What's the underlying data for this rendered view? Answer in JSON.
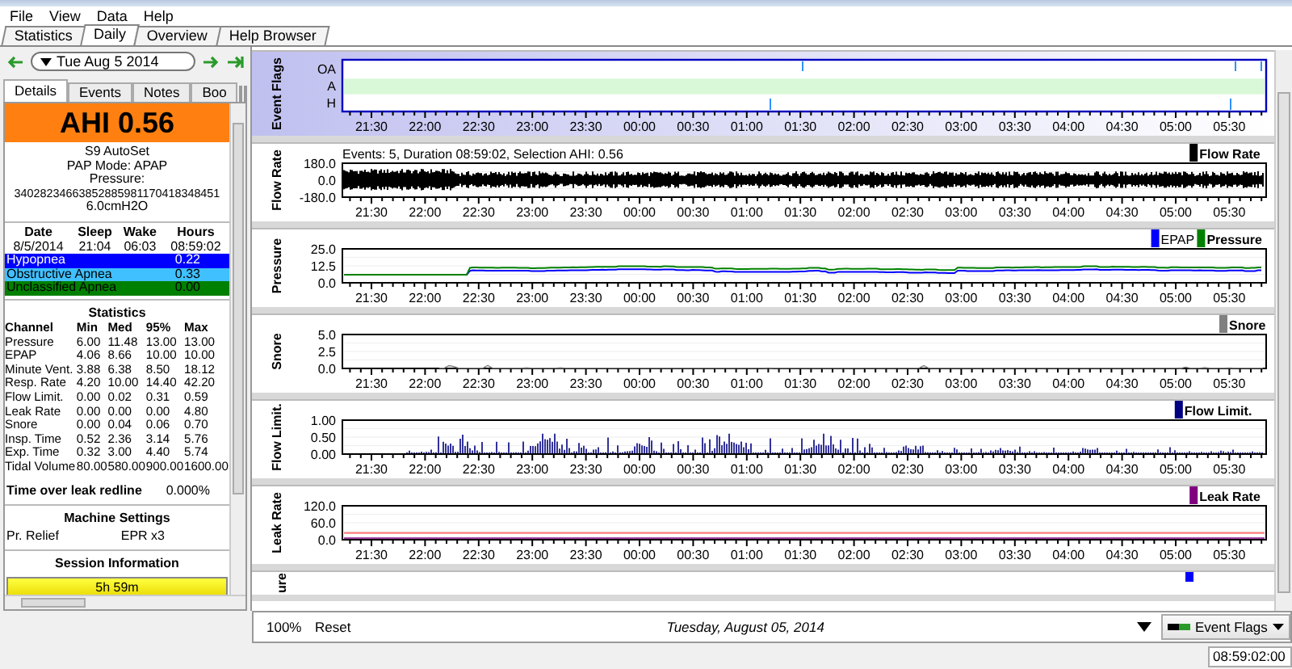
{
  "menu": [
    "File",
    "View",
    "Data",
    "Help"
  ],
  "tabs": [
    {
      "label": "Statistics",
      "selected": false
    },
    {
      "label": "Daily",
      "selected": true
    },
    {
      "label": "Overview",
      "selected": false
    },
    {
      "label": "Help Browser",
      "selected": false
    }
  ],
  "left": {
    "date": "Tue Aug 5 2014",
    "subtabs": [
      {
        "label": "Details",
        "selected": true
      },
      {
        "label": "Events",
        "selected": false
      },
      {
        "label": "Notes",
        "selected": false
      },
      {
        "label": "Boo",
        "selected": false
      }
    ],
    "ahi": "AHI 0.56",
    "machine_info": [
      "S9 AutoSet",
      "PAP Mode: APAP",
      "Pressure:",
      "34028234663852885981170418348451",
      "6.0cmH2O"
    ],
    "session_columns": [
      "Date",
      "Sleep",
      "Wake",
      "Hours"
    ],
    "session_values": [
      "8/5/2014",
      "21:04",
      "06:03",
      "08:59:02"
    ],
    "event_indices": [
      {
        "label": "Hypopnea",
        "value": "0.22",
        "color": "#0000ff"
      },
      {
        "label": "Obstructive Apnea",
        "value": "0.33",
        "color": "#40c0ff"
      },
      {
        "label": "Unclassified Apnea",
        "value": "0.00",
        "color": "#008000"
      }
    ],
    "statistics": {
      "title": "Statistics",
      "columns": [
        "Channel",
        "Min",
        "Med",
        "95%",
        "Max"
      ],
      "rows": [
        [
          "Pressure",
          "6.00",
          "11.48",
          "13.00",
          "13.00"
        ],
        [
          "EPAP",
          "4.06",
          "8.66",
          "10.00",
          "10.00"
        ],
        [
          "Minute Vent.",
          "3.88",
          "6.38",
          "8.50",
          "18.12"
        ],
        [
          "Resp. Rate",
          "4.20",
          "10.00",
          "14.40",
          "42.20"
        ],
        [
          "Flow Limit.",
          "0.00",
          "0.02",
          "0.31",
          "0.59"
        ],
        [
          "Leak Rate",
          "0.00",
          "0.00",
          "0.00",
          "4.80"
        ],
        [
          "Snore",
          "0.00",
          "0.04",
          "0.06",
          "0.70"
        ],
        [
          "Insp. Time",
          "0.52",
          "2.36",
          "3.14",
          "5.76"
        ],
        [
          "Exp. Time",
          "0.32",
          "3.00",
          "4.40",
          "5.74"
        ],
        [
          "Tidal Volume",
          "80.00",
          "580.00",
          "900.00",
          "1600.00"
        ]
      ]
    },
    "leak_redline": {
      "label": "Time over leak redline",
      "value": "0.000%"
    },
    "machine_settings": {
      "title": "Machine Settings",
      "rows": [
        {
          "label": "Pr. Relief",
          "value": "EPR x3"
        }
      ]
    },
    "session_information": {
      "title": "Session Information",
      "bar_label": "5h 59m"
    }
  },
  "graphs": [
    {
      "kind": "flags",
      "title": "Event Flags",
      "rows": [
        {
          "label": "OA",
          "highlighted": false
        },
        {
          "label": "A",
          "highlighted": true
        },
        {
          "label": "H",
          "highlighted": false
        }
      ],
      "x_labels": [
        "21:30",
        "22:00",
        "22:30",
        "23:00",
        "23:30",
        "00:00",
        "00:30",
        "01:00",
        "01:30",
        "02:00",
        "02:30",
        "03:00",
        "03:30",
        "04:00",
        "04:30",
        "05:00",
        "05:30"
      ]
    },
    {
      "kind": "flow",
      "title": "Flow Rate",
      "header": "Events: 5, Duration 08:59:02, Selection AHI: 0.56",
      "y_labels": [
        "180.0",
        "0.0",
        "-180.0"
      ],
      "legend": [
        {
          "label": "Flow Rate",
          "color": "#000000"
        }
      ],
      "x_labels": [
        "21:30",
        "22:00",
        "22:30",
        "23:00",
        "23:30",
        "00:00",
        "00:30",
        "01:00",
        "01:30",
        "02:00",
        "02:30",
        "03:00",
        "03:30",
        "04:00",
        "04:30",
        "05:00",
        "05:30"
      ]
    },
    {
      "kind": "pressure",
      "title": "Pressure",
      "y_labels": [
        "25.0",
        "12.5",
        "0.0"
      ],
      "legend": [
        {
          "label": "EPAP",
          "color": "#0000ff"
        },
        {
          "label": "Pressure",
          "color": "#008000"
        }
      ],
      "x_labels": [
        "21:30",
        "22:00",
        "22:30",
        "23:00",
        "23:30",
        "00:00",
        "00:30",
        "01:00",
        "01:30",
        "02:00",
        "02:30",
        "03:00",
        "03:30",
        "04:00",
        "04:30",
        "05:00",
        "05:30"
      ]
    },
    {
      "kind": "snore",
      "title": "Snore",
      "y_labels": [
        "5.0",
        "2.5",
        "0.0"
      ],
      "legend": [
        {
          "label": "Snore",
          "color": "#808080"
        }
      ],
      "x_labels": [
        "21:30",
        "22:00",
        "22:30",
        "23:00",
        "23:30",
        "00:00",
        "00:30",
        "01:00",
        "01:30",
        "02:00",
        "02:30",
        "03:00",
        "03:30",
        "04:00",
        "04:30",
        "05:00",
        "05:30"
      ]
    },
    {
      "kind": "flowlimit",
      "title": "Flow Limit.",
      "y_labels": [
        "1.00",
        "0.50",
        "0.00"
      ],
      "legend": [
        {
          "label": "Flow Limit.",
          "color": "#000080"
        }
      ],
      "x_labels": [
        "21:30",
        "22:00",
        "22:30",
        "23:00",
        "23:30",
        "00:00",
        "00:30",
        "01:00",
        "01:30",
        "02:00",
        "02:30",
        "03:00",
        "03:30",
        "04:00",
        "04:30",
        "05:00",
        "05:30"
      ]
    },
    {
      "kind": "leak",
      "title": "Leak Rate",
      "y_labels": [
        "120.0",
        "60.0",
        "0.0"
      ],
      "legend": [
        {
          "label": "Leak Rate",
          "color": "#800080"
        }
      ],
      "x_labels": [
        "21:30",
        "22:00",
        "22:30",
        "23:00",
        "23:30",
        "00:00",
        "00:30",
        "01:00",
        "01:30",
        "02:00",
        "02:30",
        "03:00",
        "03:30",
        "04:00",
        "04:30",
        "05:00",
        "05:30"
      ]
    },
    {
      "kind": "partial",
      "title": "ure"
    }
  ],
  "bottom_bar": {
    "zoom": "100%",
    "reset": "Reset",
    "date": "Tuesday, August 05, 2014",
    "layout": "Event Flags"
  },
  "status_bar": {
    "duration": "08:59:02:00"
  }
}
